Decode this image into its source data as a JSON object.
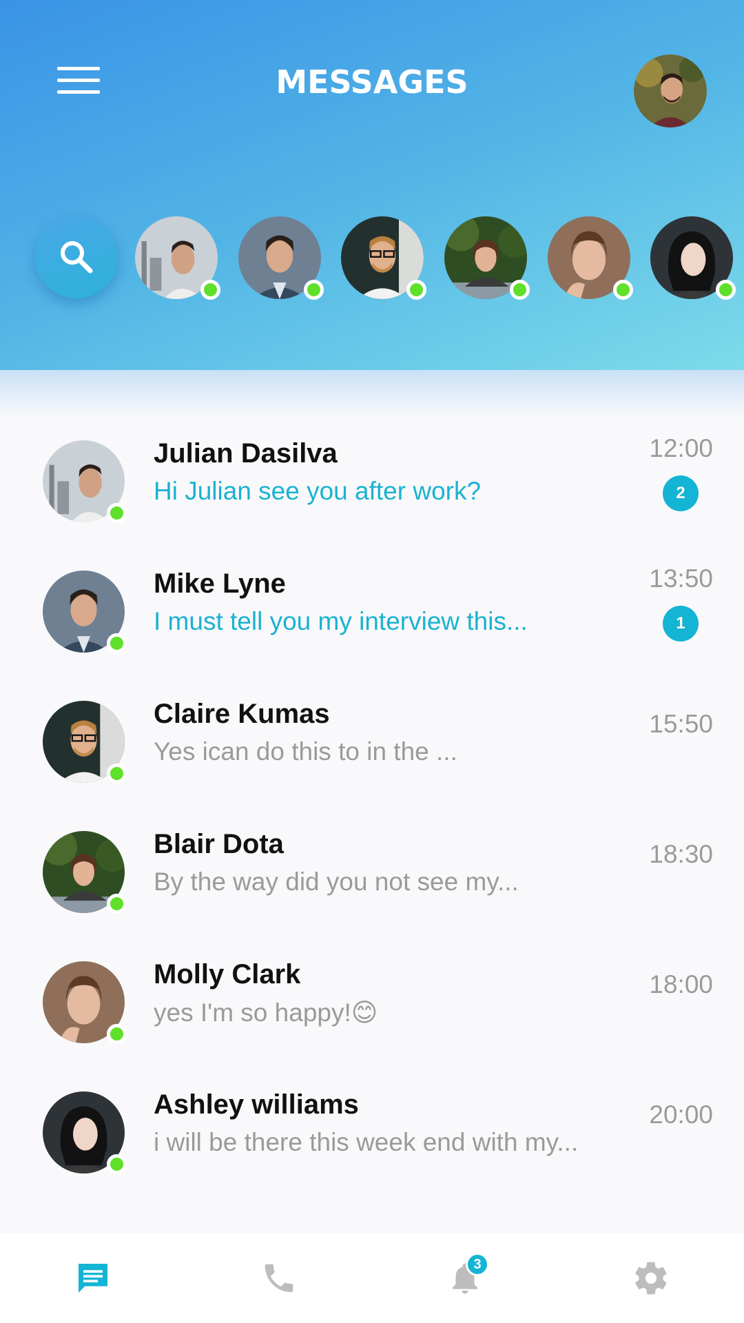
{
  "header": {
    "title": "MESSAGES",
    "menu_icon": "hamburger-menu-icon",
    "search_icon": "search-icon"
  },
  "colors": {
    "accent": "#14b4d4",
    "online": "#5fe02a",
    "header_gradient_start": "#3a93e6",
    "header_gradient_end": "#7ddbea"
  },
  "stories": [
    {
      "online": true
    },
    {
      "online": true
    },
    {
      "online": true
    },
    {
      "online": true
    },
    {
      "online": true
    },
    {
      "online": true
    }
  ],
  "chats": [
    {
      "name": "Julian Dasilva",
      "preview": "Hi Julian see you after work?",
      "time": "12:00",
      "unread": "2",
      "online": true
    },
    {
      "name": "Mike Lyne",
      "preview": "I must tell you my interview this...",
      "time": "13:50",
      "unread": "1",
      "online": true
    },
    {
      "name": "Claire Kumas",
      "preview": "Yes ican do this to in the ...",
      "time": "15:50",
      "unread": null,
      "online": true
    },
    {
      "name": "Blair Dota",
      "preview": "By the way did you not see my...",
      "time": "18:30",
      "unread": null,
      "online": true
    },
    {
      "name": "Molly Clark",
      "preview": "yes I'm so happy!😊",
      "time": "18:00",
      "unread": null,
      "online": true
    },
    {
      "name": "Ashley williams",
      "preview": "i will be there this week end with my...",
      "time": "20:00",
      "unread": null,
      "online": true
    }
  ],
  "bottom_nav": {
    "items": [
      {
        "icon": "chat-icon",
        "active": true
      },
      {
        "icon": "phone-icon",
        "active": false
      },
      {
        "icon": "bell-icon",
        "active": false
      },
      {
        "icon": "gear-icon",
        "active": false
      }
    ],
    "notifications_count": "3"
  }
}
